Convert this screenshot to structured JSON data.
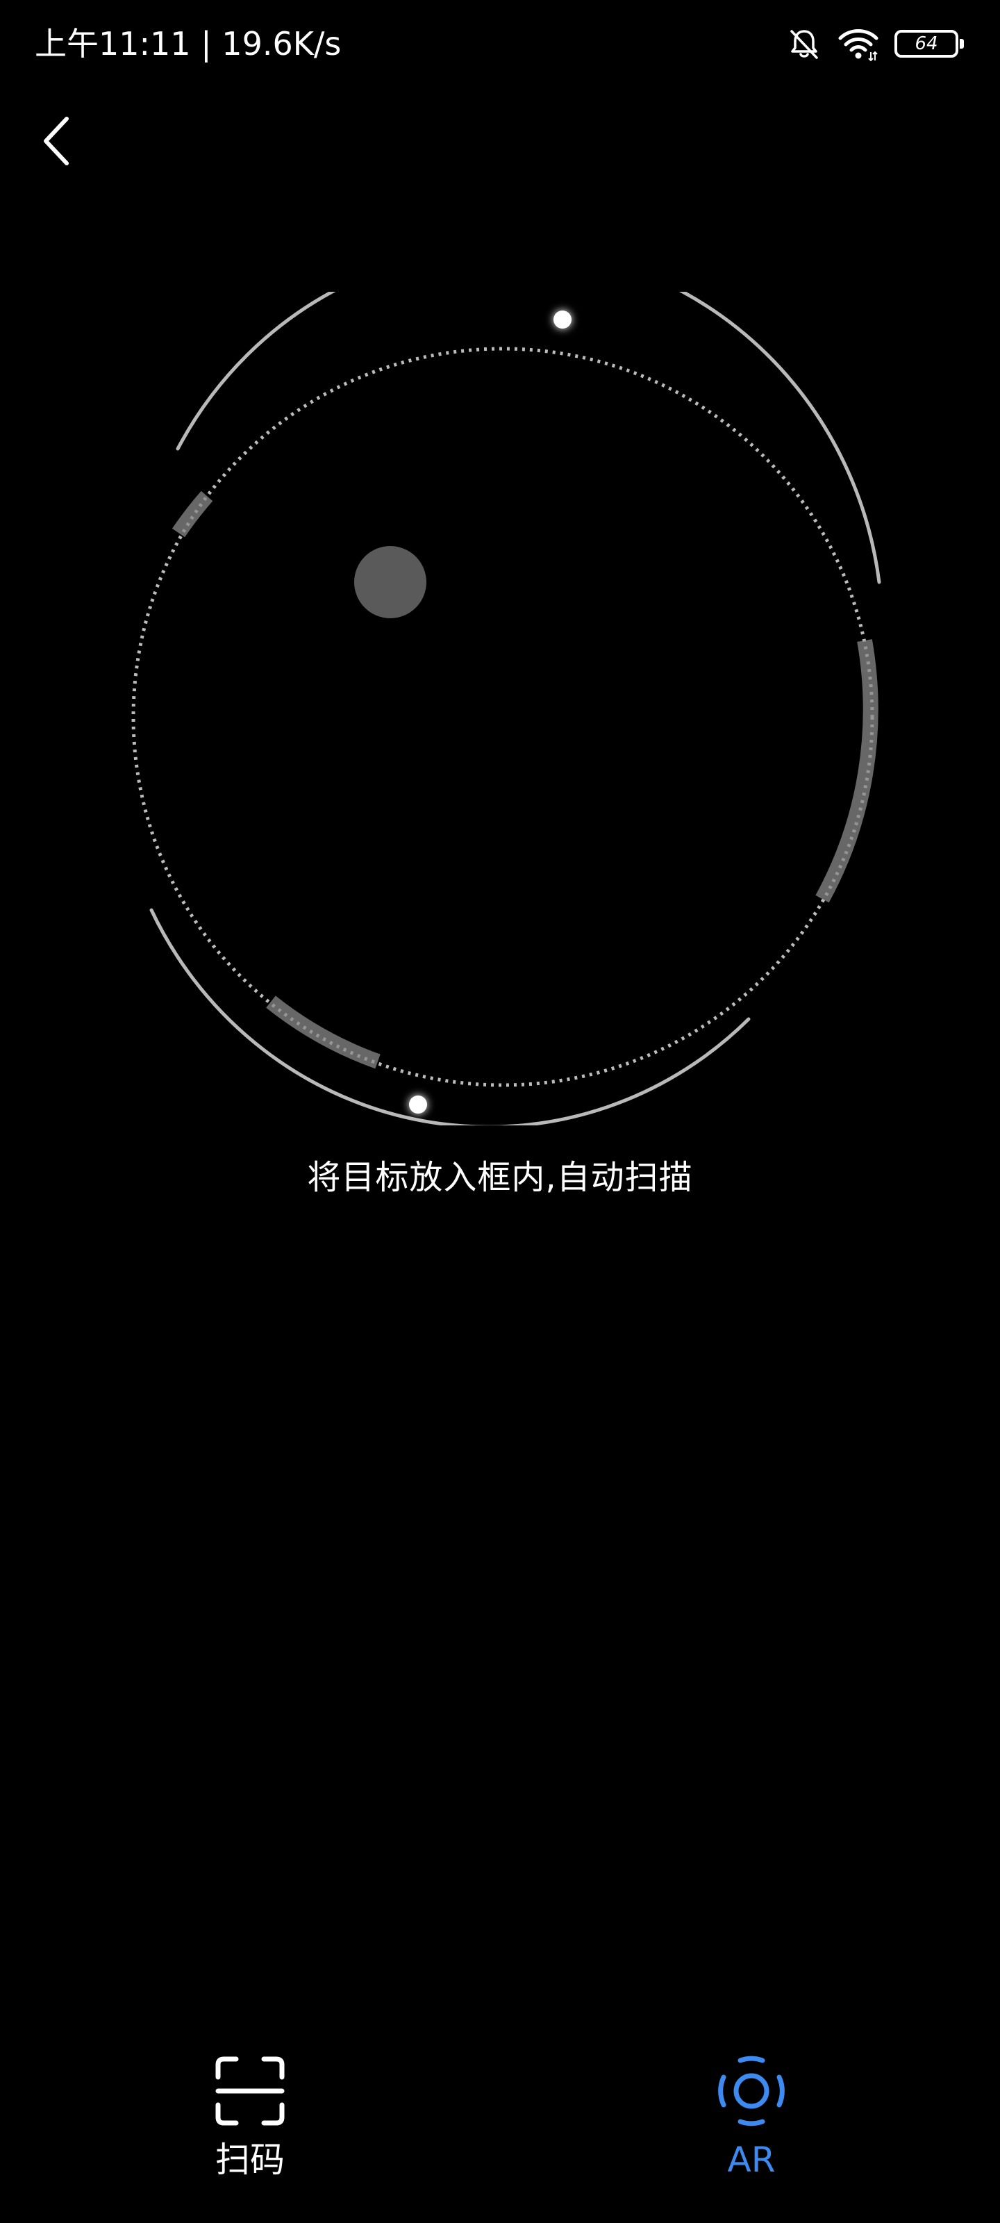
{
  "status_bar": {
    "time": "上午11:11 | 19.6K/s",
    "battery_level": "64",
    "icons": [
      "bell-muted-icon",
      "wifi-icon",
      "battery-icon"
    ]
  },
  "nav": {
    "back_icon": "chevron-left-icon"
  },
  "scan": {
    "hint": "将目标放入框内,自动扫描"
  },
  "tabs": [
    {
      "label": "扫码",
      "icon": "scan-frame-icon",
      "active": false
    },
    {
      "label": "AR",
      "icon": "ar-camera-icon",
      "active": true
    }
  ],
  "colors": {
    "background": "#000000",
    "text": "#ffffff",
    "accent": "#3d8bf0",
    "ring": "#cfcfcf"
  }
}
